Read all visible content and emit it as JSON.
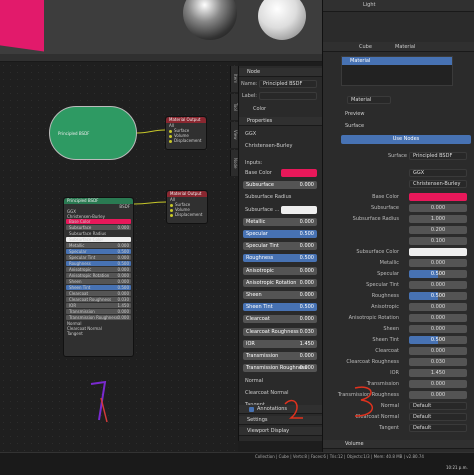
{
  "viewport": {
    "light_label": "Light"
  },
  "node_editor": {
    "green_node_label": "Principled BSDF",
    "mat_output_small": {
      "title": "Material Output",
      "target": "All",
      "sockets": [
        "Surface",
        "Volume",
        "Displacement"
      ]
    },
    "bsdf_node": {
      "title": "Principled BSDF",
      "out": "BSDF",
      "dist": "GGX",
      "sss": "Christensen-Burley",
      "rows": [
        {
          "name": "Base Color",
          "value": "",
          "type": "color"
        },
        {
          "name": "Subsurface",
          "value": "0.000"
        },
        {
          "name": "Subsurface Radius",
          "value": "",
          "type": "drop"
        },
        {
          "name": "Subsurface Color",
          "value": "",
          "type": "white"
        },
        {
          "name": "Metallic",
          "value": "0.000"
        },
        {
          "name": "Specular",
          "value": "0.500",
          "hl": true
        },
        {
          "name": "Specular Tint",
          "value": "0.000"
        },
        {
          "name": "Roughness",
          "value": "0.500",
          "hl": true
        },
        {
          "name": "Anisotropic",
          "value": "0.000"
        },
        {
          "name": "Anisotropic Rotation",
          "value": "0.000"
        },
        {
          "name": "Sheen",
          "value": "0.000"
        },
        {
          "name": "Sheen Tint",
          "value": "0.500",
          "hl": true
        },
        {
          "name": "Clearcoat",
          "value": "0.000"
        },
        {
          "name": "Clearcoat Roughness",
          "value": "0.030"
        },
        {
          "name": "IOR",
          "value": "1.450"
        },
        {
          "name": "Transmission",
          "value": "0.000"
        },
        {
          "name": "Transmission Roughness",
          "value": "0.000"
        }
      ],
      "tail": [
        "Normal",
        "Clearcoat Normal",
        "Tangent"
      ]
    },
    "mat_output_large": {
      "title": "Material Output",
      "target": "All",
      "sockets": [
        "Surface",
        "Volume",
        "Displacement"
      ]
    }
  },
  "npanel": {
    "node_header": "Node",
    "name_label": "Name:",
    "name_value": "Principled BSDF",
    "label_label": "Label:",
    "color_label": "Color",
    "properties_header": "Properties",
    "dist": "GGX",
    "sss": "Christensen-Burley",
    "inputs_label": "Inputs:",
    "rows": [
      {
        "name": "Base Color",
        "type": "color"
      },
      {
        "name": "Subsurface",
        "value": "0.000",
        "type": "num"
      },
      {
        "name": "Subsurface Radius",
        "type": "drop"
      },
      {
        "name": "Subsurface ...",
        "type": "white"
      },
      {
        "name": "Metallic",
        "value": "0.000",
        "type": "num"
      },
      {
        "name": "Specular",
        "value": "0.500",
        "type": "hl"
      },
      {
        "name": "Specular Tint",
        "value": "0.000",
        "type": "num"
      },
      {
        "name": "Roughness",
        "value": "0.500",
        "type": "hl"
      },
      {
        "name": "Anisotropic",
        "value": "0.000",
        "type": "num"
      },
      {
        "name": "Anisotropic Rotation",
        "value": "0.000",
        "type": "num"
      },
      {
        "name": "Sheen",
        "value": "0.000",
        "type": "num"
      },
      {
        "name": "Sheen Tint",
        "value": "0.500",
        "type": "hl"
      },
      {
        "name": "Clearcoat",
        "value": "0.000",
        "type": "num"
      },
      {
        "name": "Clearcoat Roughness",
        "value": "0.030",
        "type": "num"
      },
      {
        "name": "IOR",
        "value": "1.450",
        "type": "num"
      },
      {
        "name": "Transmission",
        "value": "0.000",
        "type": "num"
      },
      {
        "name": "Transmission Roughness",
        "value": "0.000",
        "type": "num"
      }
    ],
    "tail": [
      "Normal",
      "Clearcoat Normal",
      "Tangent"
    ],
    "annotations": "Annotations",
    "settings": "Settings",
    "viewport_display": "Viewport Display",
    "tabs": [
      "Item",
      "Tool",
      "View",
      "Node"
    ]
  },
  "props": {
    "light": "Light",
    "breadcrumb_obj": "Cube",
    "breadcrumb_mat": "Material",
    "slot_name": "Material",
    "mat_name": "Material",
    "preview": "Preview",
    "surface": "Surface",
    "use_nodes": "Use Nodes",
    "surface_label": "Surface",
    "surface_value": "Principled BSDF",
    "dist": "GGX",
    "sss": "Christensen-Burley",
    "rows": [
      {
        "name": "Base Color",
        "type": "color"
      },
      {
        "name": "Subsurface",
        "value": "0.000",
        "type": "num"
      },
      {
        "name": "Subsurface Radius",
        "value": "1.000",
        "type": "num"
      },
      {
        "name": "",
        "value": "0.200",
        "type": "num"
      },
      {
        "name": "",
        "value": "0.100",
        "type": "num"
      },
      {
        "name": "Subsurface Color",
        "type": "white"
      },
      {
        "name": "Metallic",
        "value": "0.000",
        "type": "num"
      },
      {
        "name": "Specular",
        "value": "0.500",
        "type": "hl"
      },
      {
        "name": "Specular Tint",
        "value": "0.000",
        "type": "num"
      },
      {
        "name": "Roughness",
        "value": "0.500",
        "type": "hl"
      },
      {
        "name": "Anisotropic",
        "value": "0.000",
        "type": "num"
      },
      {
        "name": "Anisotropic Rotation",
        "value": "0.000",
        "type": "num"
      },
      {
        "name": "Sheen",
        "value": "0.000",
        "type": "num"
      },
      {
        "name": "Sheen Tint",
        "value": "0.500",
        "type": "hl"
      },
      {
        "name": "Clearcoat",
        "value": "0.000",
        "type": "num"
      },
      {
        "name": "Clearcoat Roughness",
        "value": "0.030",
        "type": "num"
      },
      {
        "name": "IOR",
        "value": "1.450",
        "type": "num"
      },
      {
        "name": "Transmission",
        "value": "0.000",
        "type": "num"
      },
      {
        "name": "Transmission Roughness",
        "value": "0.000",
        "type": "num"
      },
      {
        "name": "Normal",
        "value": "Default",
        "type": "def"
      },
      {
        "name": "Clearcoat Normal",
        "value": "Default",
        "type": "def"
      },
      {
        "name": "Tangent",
        "value": "Default",
        "type": "def"
      }
    ],
    "volume": "Volume"
  },
  "status": {
    "info": "Collection | Cube | Verts:8 | Faces:6 | Tris:12 | Objects:1/3 | Mem: 40.8 MB | v2.80.74",
    "time": "10:21 p.m."
  },
  "colors": {
    "accent": "#4772b3",
    "base_color": "#e8185a",
    "node_green": "#2e9a63",
    "annotation": "#e0321e"
  }
}
